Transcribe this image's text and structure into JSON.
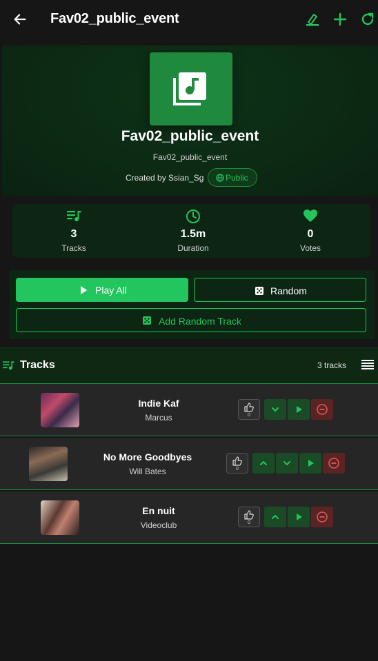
{
  "header": {
    "title": "Fav02_public_event",
    "icons": [
      "arrow-left-icon",
      "edit-icon",
      "plus-icon",
      "refresh-icon"
    ]
  },
  "hero": {
    "title": "Fav02_public_event",
    "subtitle": "Fav02_public_event",
    "created_by": "Created by Ssian_Sg",
    "visibility": "Public"
  },
  "stats": {
    "tracks": {
      "value": "3",
      "label": "Tracks"
    },
    "duration": {
      "value": "1.5m",
      "label": "Duration"
    },
    "votes": {
      "value": "0",
      "label": "Votes"
    }
  },
  "actions": {
    "play_all": "Play All",
    "random": "Random",
    "add_random": "Add Random Track"
  },
  "tracks_section": {
    "title": "Tracks",
    "count": "3 tracks"
  },
  "tracks": [
    {
      "name": "Indie Kaf",
      "artist": "Marcus",
      "votes": "0"
    },
    {
      "name": "No More Goodbyes",
      "artist": "Will Bates",
      "votes": "0"
    },
    {
      "name": "En nuit",
      "artist": "Videoclub",
      "votes": "0"
    }
  ],
  "colors": {
    "accent": "#22c55e",
    "accent_dark": "#1f8a3e",
    "danger_bg": "#5a2424",
    "background": "#161616"
  }
}
